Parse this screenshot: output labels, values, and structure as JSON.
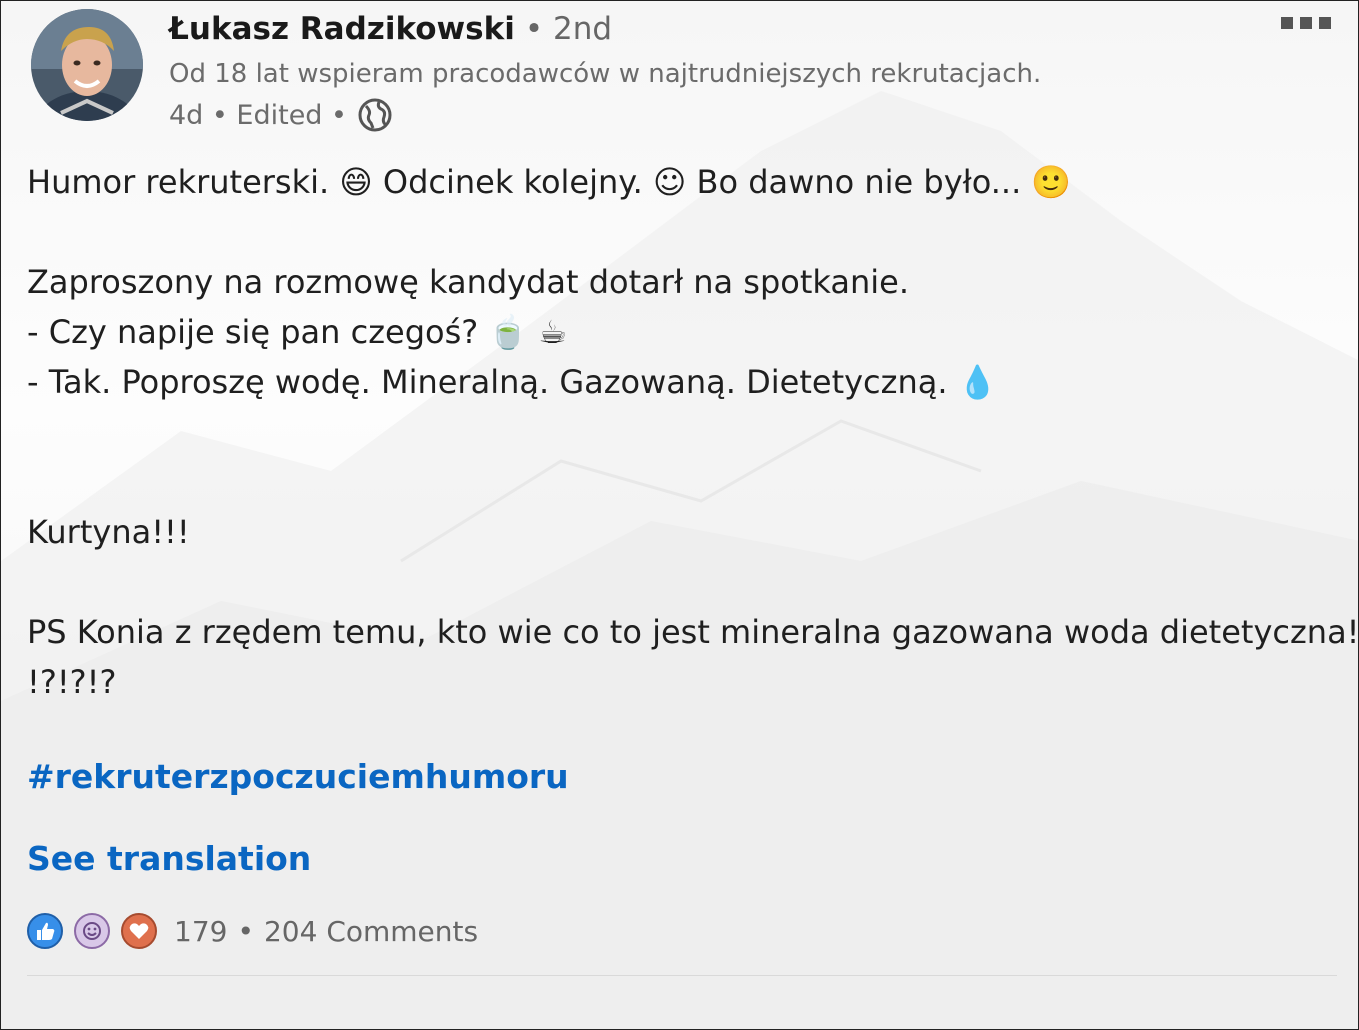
{
  "author": {
    "name": "Łukasz Radzikowski",
    "degree": "• 2nd",
    "headline": "Od 18 lat wspieram pracodawców w najtrudniejszych rekrutacjach.",
    "meta": "4d • Edited •"
  },
  "post": {
    "line1_a": "Humor rekruterski. ",
    "line1_e1": "😄",
    "line1_b": " Odcinek kolejny. ",
    "line1_e2": "☺",
    "line1_c": " Bo dawno nie było... ",
    "line1_e3": "🙂",
    "line2": "Zaproszony na rozmowę kandydat dotarł na spotkanie.",
    "line3_a": "- Czy napije się pan czegoś? ",
    "line3_e1": "🍵",
    "line3_e2": "☕",
    "line4_a": "- Tak. Poproszę wodę. Mineralną. Gazowaną. Dietetyczną. ",
    "line4_e1": "💧",
    "line5": "Kurtyna!!!",
    "line6": "PS Konia z rzędem temu, kto wie co to jest mineralna gazowana woda dietetyczna!",
    "line7": "!?!?!?",
    "hashtag": "#rekruterzpoczuciemhumoru",
    "see_translation": "See translation"
  },
  "social": {
    "reaction_icons": [
      "like-icon",
      "funny-icon",
      "love-icon"
    ],
    "reaction_count": "179",
    "separator": "•",
    "comments": "204 Comments"
  },
  "colors": {
    "link": "#0a66c2",
    "like": "#378fe9",
    "love": "#df704d",
    "funny": "#d9c8e8"
  }
}
